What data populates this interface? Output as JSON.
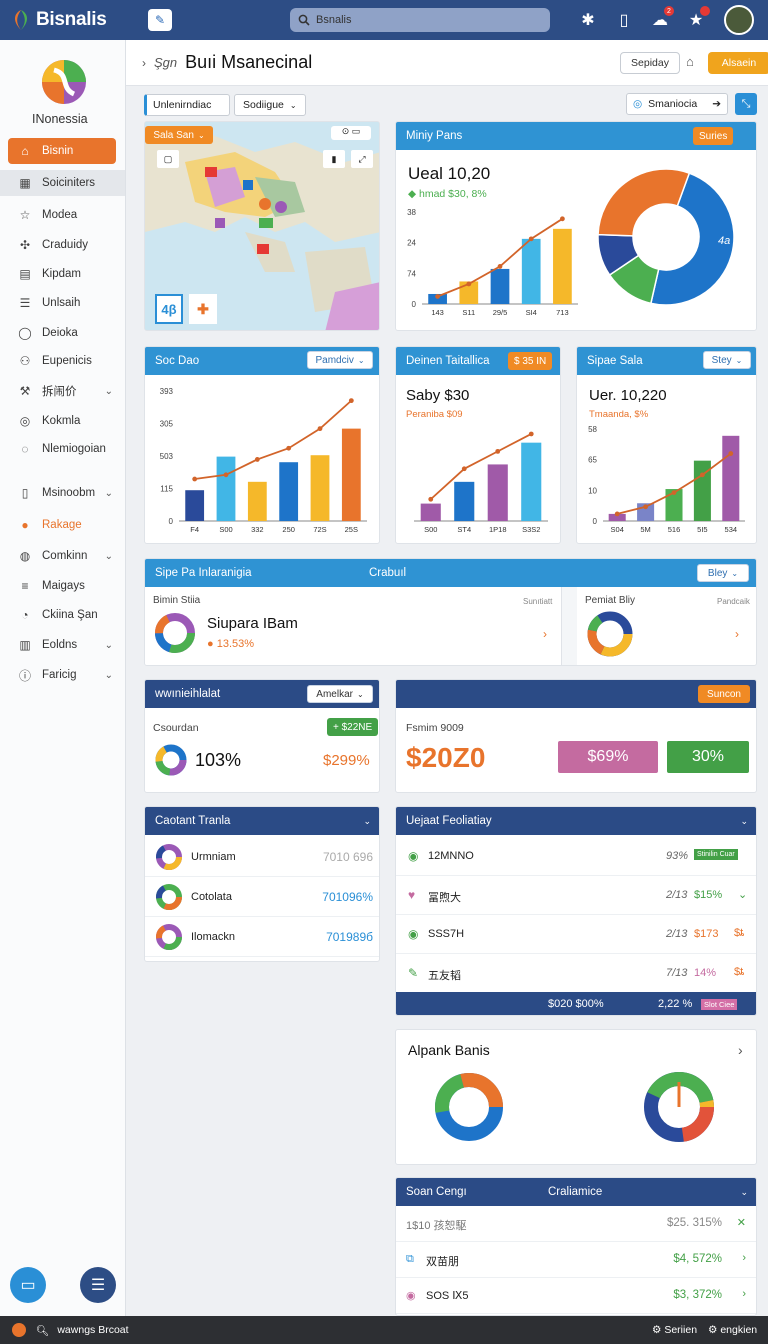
{
  "app": {
    "brand": "Bisnalis",
    "search_placeholder": "Bsnalis"
  },
  "sidebar": {
    "logo_caption": "INonessia",
    "items": [
      {
        "label": "Bisnin",
        "icon": "home-icon"
      },
      {
        "label": "Soiciniters",
        "icon": "grid-icon"
      },
      {
        "label": "Modea",
        "icon": "star-icon"
      },
      {
        "label": "Craduidy",
        "icon": "puzzle-icon"
      },
      {
        "label": "Kipdam",
        "icon": "chart-icon"
      },
      {
        "label": "Unlsaih",
        "icon": "list-icon"
      },
      {
        "label": "Deioka",
        "icon": "chat-icon"
      },
      {
        "label": "Eupenicis",
        "icon": "users-icon"
      },
      {
        "label": "拆闹价",
        "icon": "tools-icon"
      },
      {
        "label": "Kokmla",
        "icon": "camera-icon"
      },
      {
        "label": "Nlemiogoian",
        "icon": "bubble-icon"
      },
      {
        "label": "Msinoobm",
        "icon": "document-icon"
      },
      {
        "label": "Rakage",
        "icon": "package-icon"
      },
      {
        "label": "Comkinn",
        "icon": "globe-icon"
      },
      {
        "label": "Maigays",
        "icon": "bars-icon"
      },
      {
        "label": "Ckiina Şan",
        "icon": "clock-icon"
      },
      {
        "label": "Eoldns",
        "icon": "book-icon"
      },
      {
        "label": "Faricig",
        "icon": "info-icon"
      }
    ]
  },
  "header": {
    "prefix": "Şgn",
    "title": "Buıi Msanecinal",
    "btn_outline": "Sepiday",
    "btn_orange": "Alsaein"
  },
  "filters": {
    "field1": "Unlenirndiac",
    "field2": "Sodiigue",
    "search_value": "Smaniocia"
  },
  "map_card": {
    "chip": "Sala San",
    "tile1": "4β"
  },
  "card_pie": {
    "title": "Miniy Pans",
    "chip": "Suries",
    "big": "Ueal 10,20",
    "sub": "hmad $30, 8%"
  },
  "card_a": {
    "title": "Soc Dao",
    "dropdown": "Pamdciv"
  },
  "card_b": {
    "title": "Deinen Taitallica",
    "chip": "$ 35 IN",
    "big": "Saby $30",
    "sub": "Peraniba $09"
  },
  "card_c": {
    "title": "Sipae Sala",
    "dropdown": "Stey",
    "big": "Uer. 10,220",
    "sub": "Tmaanda, $%"
  },
  "wide_card": {
    "title": "Sipe Pa Inlaranigia",
    "title2": "Crabuıl",
    "dropdown": "Bley",
    "left": {
      "label": "Bimin Stiia",
      "tag": "Sunıtiatt",
      "big": "Siupara IBam",
      "pct": "13.53%"
    },
    "right": {
      "label": "Pemiat Bliy",
      "tag": "Pandcaik"
    }
  },
  "stat_left": {
    "title": "wwınieihlalat",
    "dropdown": "Amelkar",
    "label": "Csourdan",
    "chip": "+ $22NE",
    "pct": "103%",
    "val": "$299%"
  },
  "stat_right": {
    "chip": "Suncon",
    "label": "Fsmim 9009",
    "big": "$20Z0",
    "btn1": "$69%",
    "btn2": "30%"
  },
  "list_left": {
    "title": "Caotant Tranla",
    "rows": [
      {
        "name": "Urmniam",
        "value": "7010 696"
      },
      {
        "name": "Cotolata",
        "value": "701096%"
      },
      {
        "name": "Ilomackn",
        "value": "701989б"
      }
    ]
  },
  "list_right": {
    "title": "Uejaat Feoliatiay",
    "rows": [
      {
        "name": "12MNNO",
        "ratio": "93%",
        "amount": "",
        "tag": "Stinilin Cuar"
      },
      {
        "name": "冨煦大",
        "ratio": "2/13",
        "amount": "$15%",
        "tag": ""
      },
      {
        "name": "SSS7H",
        "ratio": "2/13",
        "amount": "$173",
        "tag": "$ȶ"
      },
      {
        "name": "五友韬",
        "ratio": "7/13",
        "amount": "14%",
        "tag": "$ȶ"
      }
    ],
    "footer_total": "$020 $00%",
    "footer_pct": "2,22 %",
    "footer_tag": "Slot Ciee"
  },
  "donut_card": {
    "title": "Alpank Banis"
  },
  "bottom_list": {
    "title": "Soan Cengı",
    "title2": "Craliamice",
    "rows": [
      {
        "name": "1$10 孩恕駆",
        "value": "$25. 315%"
      },
      {
        "name": "双苗朋",
        "value": "$4, 572%"
      },
      {
        "name": "SOS Ⅸ5",
        "value": "$3, 372%"
      }
    ]
  },
  "bottombar": {
    "text": "wawngs Brcoat",
    "right1": "Seriien",
    "right2": "engkien"
  },
  "colors": {
    "navy": "#2d4d85",
    "blue": "#2f93d3",
    "orange": "#e8742c",
    "green": "#4caf50",
    "purple": "#9b59b6",
    "yellow": "#f5b82a"
  },
  "chart_data": [
    {
      "type": "bar",
      "title": "Miniy Pans",
      "categories": [
        "143",
        "S11",
        "29/5",
        "SI4",
        "713"
      ],
      "values": [
        4,
        9,
        14,
        26,
        30
      ],
      "line": [
        3,
        8,
        15,
        26,
        34
      ],
      "yticks": [
        "0",
        "74",
        "24",
        "38"
      ]
    },
    {
      "type": "pie",
      "title": "Miniy Pans",
      "labels": [
        "4a"
      ],
      "values": [
        48,
        12,
        10,
        30
      ],
      "colors": [
        "#1e74c9",
        "#4caf50",
        "#2a4a9a",
        "#e8742c"
      ]
    },
    {
      "type": "bar",
      "title": "Soc Dao",
      "categories": [
        "F4",
        "S00",
        "332",
        "250",
        "72S",
        "25S"
      ],
      "values": [
        110,
        230,
        140,
        210,
        235,
        330
      ],
      "line": [
        150,
        165,
        220,
        260,
        330,
        430
      ],
      "yticks": [
        "0",
        "115",
        "503",
        "305",
        "393"
      ]
    },
    {
      "type": "bar",
      "title": "Deinen Taitallica",
      "categories": [
        "S00",
        "ST4",
        "1P18",
        "S3S2"
      ],
      "values": [
        8,
        18,
        26,
        36
      ],
      "line": [
        10,
        24,
        32,
        40
      ]
    },
    {
      "type": "bar",
      "title": "Sipae Sala",
      "categories": [
        "S04",
        "5M",
        "516",
        "5I5",
        "534"
      ],
      "values": [
        2,
        5,
        9,
        17,
        24
      ],
      "line": [
        2,
        4,
        8,
        13,
        19
      ],
      "yticks": [
        "0",
        "10",
        "65",
        "58"
      ]
    }
  ]
}
